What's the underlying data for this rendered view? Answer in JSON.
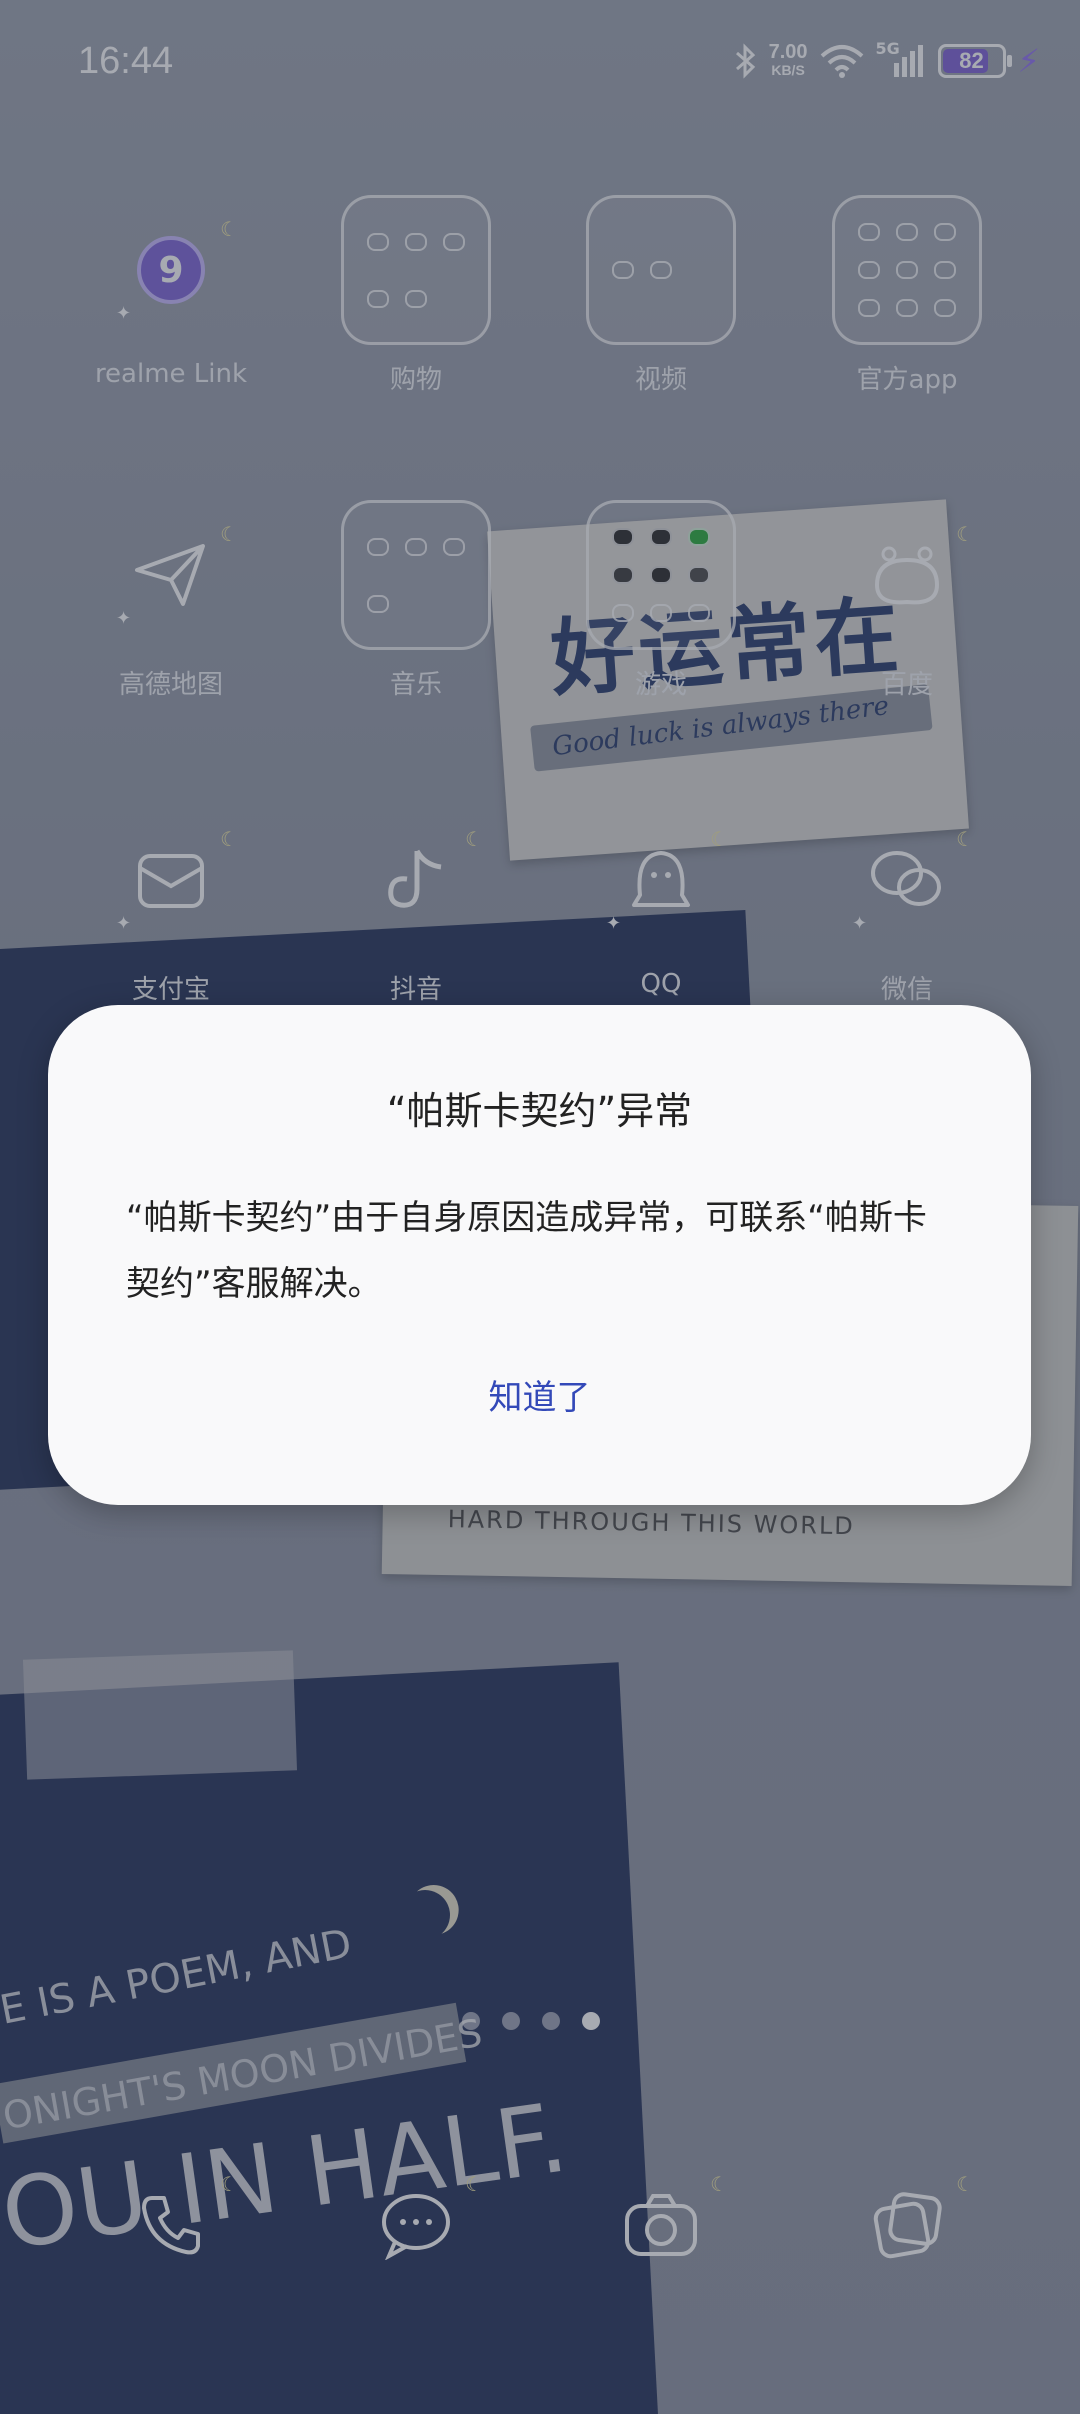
{
  "status_bar": {
    "time": "16:44",
    "net_speed_value": "7.00",
    "net_speed_unit": "KB/S",
    "signal": "5G",
    "battery": "82",
    "battery_level": 0.82,
    "battery_color": "#7b5bd6"
  },
  "apps": [
    {
      "label": "realme Link"
    },
    {
      "label": "购物"
    },
    {
      "label": "视频"
    },
    {
      "label": "官方app"
    },
    {
      "label": "高德地图"
    },
    {
      "label": "音乐"
    },
    {
      "label": "游戏"
    },
    {
      "label": "百度"
    },
    {
      "label": "支付宝"
    },
    {
      "label": "抖音"
    },
    {
      "label": "QQ"
    },
    {
      "label": "微信"
    }
  ],
  "dock": [
    {
      "icon": "phone-icon"
    },
    {
      "icon": "messages-icon"
    },
    {
      "icon": "camera-icon"
    },
    {
      "icon": "gallery-icon"
    }
  ],
  "wallpaper": {
    "note_title": "好运常在",
    "note_subtitle": "Good luck is always there",
    "note2_text": "HARD THROUGH THIS WORLD",
    "poem_line1": "FE IS A POEM, AND",
    "poem_line2": "ONIGHT'S MOON DIVIDES",
    "poem_line3": "OU IN HALF."
  },
  "dialog": {
    "title": "“帕斯卡契约”异常",
    "message": "“帕斯卡契约”由于自身原因造成异常，可联系“帕斯卡契约”客服解决。",
    "button": "知道了",
    "button_color": "#3349b8"
  },
  "pager": {
    "pages": 4,
    "current": 4
  }
}
